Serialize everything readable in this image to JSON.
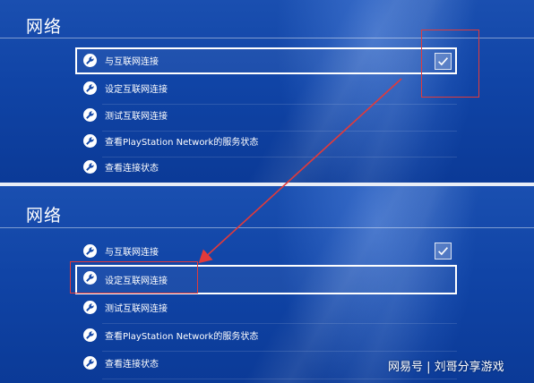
{
  "top": {
    "title": "网络",
    "items": [
      {
        "label": "与互联网连接"
      },
      {
        "label": "设定互联网连接"
      },
      {
        "label": "测试互联网连接"
      },
      {
        "label": "查看PlayStation Network的服务状态"
      },
      {
        "label": "查看连接状态"
      }
    ],
    "checkbox_checked": true
  },
  "bottom": {
    "title": "网络",
    "items": [
      {
        "label": "与互联网连接"
      },
      {
        "label": "设定互联网连接"
      },
      {
        "label": "测试互联网连接"
      },
      {
        "label": "查看PlayStation Network的服务状态"
      },
      {
        "label": "查看连接状态"
      }
    ],
    "checkbox_checked": true
  },
  "watermark": "网易号 | 刘哥分享游戏",
  "colors": {
    "background": "#1044a6",
    "annotation_red": "#e23a3a",
    "text": "#ffffff"
  },
  "icons": {
    "item_icon": "wrench-icon",
    "checkbox_icon": "checkmark-icon"
  }
}
